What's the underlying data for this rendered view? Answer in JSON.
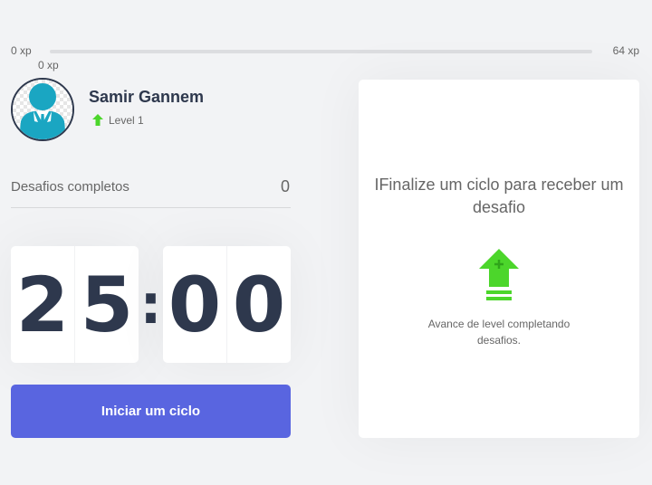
{
  "experience": {
    "min_label": "0 xp",
    "max_label": "64 xp",
    "current_label": "0 xp",
    "progress": 0
  },
  "profile": {
    "name": "Samir Gannem",
    "level_label": "Level 1",
    "avatar_icon": "user-avatar-icon",
    "level_icon": "level-up-arrow-icon"
  },
  "completed_challenges": {
    "label": "Desafios completos",
    "value": "0"
  },
  "countdown": {
    "minute_left": "2",
    "minute_right": "5",
    "separator": ":",
    "second_left": "0",
    "second_right": "0"
  },
  "start_button": {
    "label": "Iniciar um ciclo"
  },
  "challenge_box": {
    "title": "IFinalize um ciclo para receber um desafio",
    "icon": "level-up-icon",
    "hint": "Avance de level completando desafios."
  },
  "colors": {
    "background": "#f2f3f5",
    "title": "#2e384d",
    "text": "#666666",
    "primary": "#5965e0",
    "green": "#4cd62b",
    "avatar_blue": "#1aa6c2"
  }
}
